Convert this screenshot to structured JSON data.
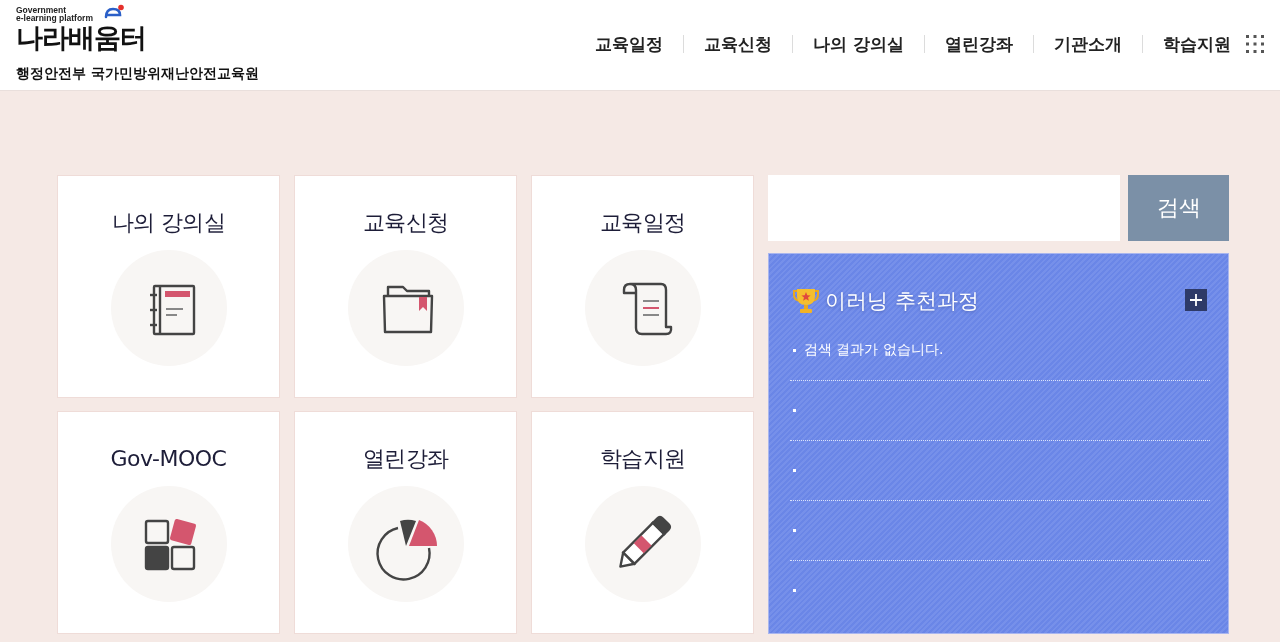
{
  "header": {
    "logo": {
      "tagline": [
        "Government",
        "e-learning platform"
      ],
      "wordmark": "나라배움터",
      "org": "행정안전부 국가민방위재난안전교육원"
    },
    "nav": [
      "교육일정",
      "교육신청",
      "나의 강의실",
      "열린강좌",
      "기관소개",
      "학습지원"
    ]
  },
  "menu_cards": [
    {
      "title": "나의 강의실"
    },
    {
      "title": "교육신청"
    },
    {
      "title": "교육일정"
    },
    {
      "title": "Gov-MOOC"
    },
    {
      "title": "열린강좌"
    },
    {
      "title": "학습지원"
    }
  ],
  "search": {
    "button": "검색"
  },
  "recommend": {
    "title": "이러닝 추천과정",
    "rows": [
      {
        "kind": "text",
        "text": "검색 결과가 없습니다."
      },
      {
        "kind": "blank"
      },
      {
        "kind": "blank"
      },
      {
        "kind": "blank"
      },
      {
        "kind": "blank"
      }
    ]
  }
}
